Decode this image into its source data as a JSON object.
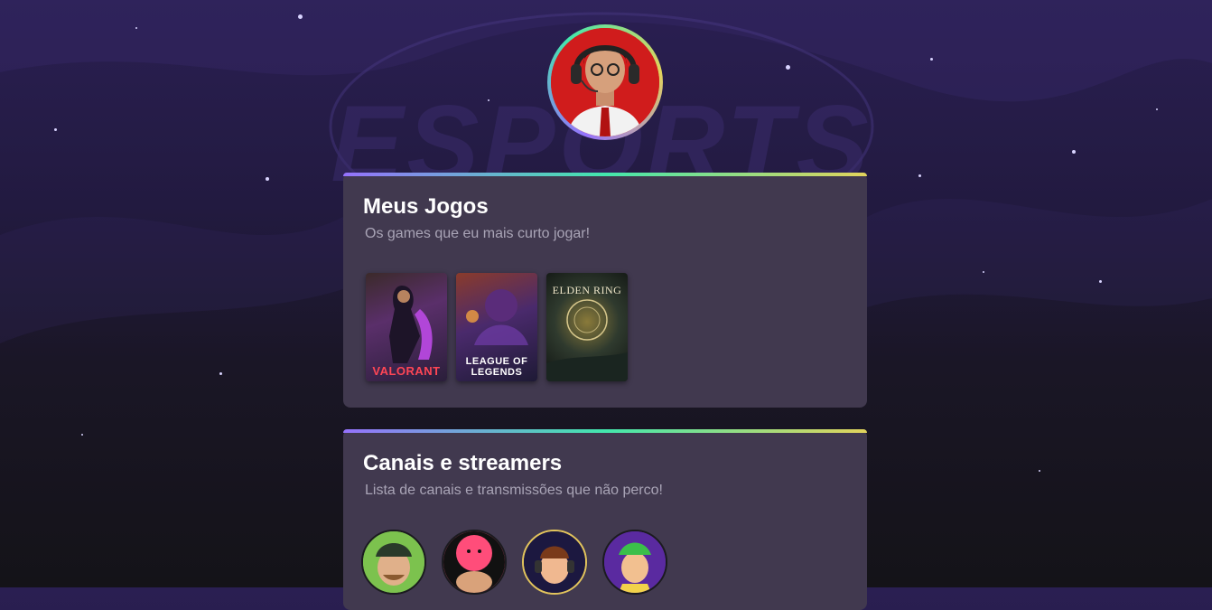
{
  "profile": {
    "avatar_icon": "profile-photo-avatar"
  },
  "background": {
    "watermark_text": "ESPORTS",
    "colors": {
      "top": "#2a1f52",
      "bottom": "#141318"
    }
  },
  "games_section": {
    "title": "Meus Jogos",
    "subtitle": "Os games que eu mais curto jogar!",
    "games": [
      {
        "title": "VALORANT",
        "icon": "valorant-cover"
      },
      {
        "title": "LEAGUE OF LEGENDS",
        "icon": "league-of-legends-cover"
      },
      {
        "title": "ELDEN RING",
        "icon": "elden-ring-cover"
      }
    ]
  },
  "channels_section": {
    "title": "Canais e streamers",
    "subtitle": "Lista de canais e transmissões que não perco!",
    "channels": [
      {
        "icon": "streamer-avatar-1"
      },
      {
        "icon": "streamer-avatar-2"
      },
      {
        "icon": "streamer-avatar-3"
      },
      {
        "icon": "streamer-avatar-4"
      }
    ]
  },
  "accent_gradient": [
    "#9572fc",
    "#43e7ad",
    "#e2d45c"
  ]
}
